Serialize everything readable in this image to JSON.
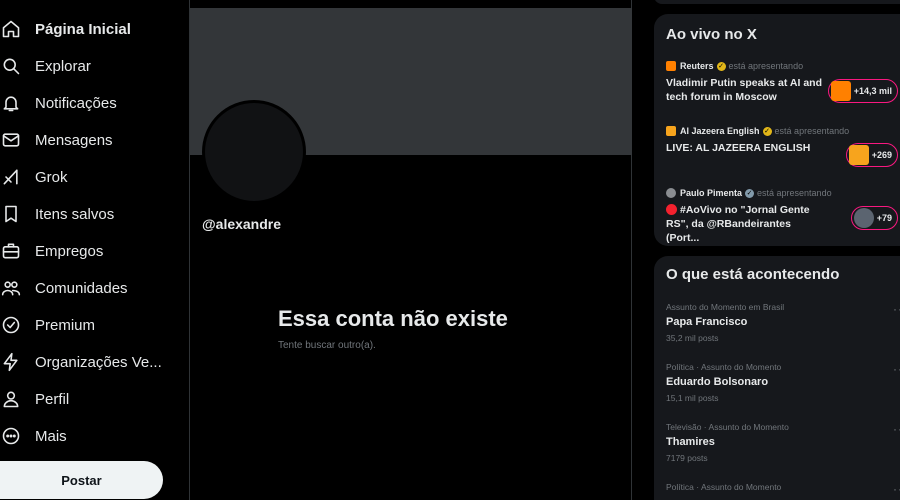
{
  "nav": {
    "items": [
      {
        "label": "Página Inicial",
        "icon": "home-icon"
      },
      {
        "label": "Explorar",
        "icon": "search-icon"
      },
      {
        "label": "Notificações",
        "icon": "bell-icon"
      },
      {
        "label": "Mensagens",
        "icon": "envelope-icon"
      },
      {
        "label": "Grok",
        "icon": "grok-icon"
      },
      {
        "label": "Itens salvos",
        "icon": "bookmark-icon"
      },
      {
        "label": "Empregos",
        "icon": "briefcase-icon"
      },
      {
        "label": "Comunidades",
        "icon": "people-icon"
      },
      {
        "label": "Premium",
        "icon": "verified-badge-icon"
      },
      {
        "label": "Organizações Ve...",
        "icon": "lightning-icon"
      },
      {
        "label": "Perfil",
        "icon": "user-icon"
      },
      {
        "label": "Mais",
        "icon": "more-circle-icon"
      }
    ],
    "post_label": "Postar"
  },
  "profile": {
    "handle": "@alexandre",
    "empty_title": "Essa conta não existe",
    "empty_subtitle": "Tente buscar outro(a)."
  },
  "live": {
    "title": "Ao vivo no X",
    "items": [
      {
        "source": "Reuters",
        "presenting": "está apresentando",
        "text": "Vladimir Putin speaks at AI and tech forum in Moscow",
        "count": "+14,3 mil",
        "source_color": "#ff8000",
        "badge": "gold"
      },
      {
        "source": "Al Jazeera English",
        "presenting": "está apresentando",
        "text": "LIVE: AL JAZEERA ENGLISH",
        "count": "+269",
        "source_color": "#f7a41d",
        "badge": "gold"
      },
      {
        "source": "Paulo Pimenta",
        "presenting": "está apresentando",
        "text": "#AoVivo no \"Jornal Gente RS\", da @RBandeirantes (Port...",
        "count": "+79",
        "source_color": "#8a8d91",
        "badge": "gray"
      }
    ]
  },
  "trends": {
    "title": "O que está acontecendo",
    "items": [
      {
        "context": "Assunto do Momento em Brasil",
        "name": "Papa Francisco",
        "count": "35,2 mil posts"
      },
      {
        "context": "Política · Assunto do Momento",
        "name": "Eduardo Bolsonaro",
        "count": "15,1 mil posts"
      },
      {
        "context": "Televisão · Assunto do Momento",
        "name": "Thamires",
        "count": "7179 posts"
      },
      {
        "context": "Política · Assunto do Momento",
        "name": "",
        "count": ""
      }
    ],
    "more_label": "···"
  },
  "colors": {
    "background": "#000000",
    "banner": "#333639",
    "card": "#16181c",
    "live_accent": "#f91880",
    "muted_text": "#71767b"
  }
}
